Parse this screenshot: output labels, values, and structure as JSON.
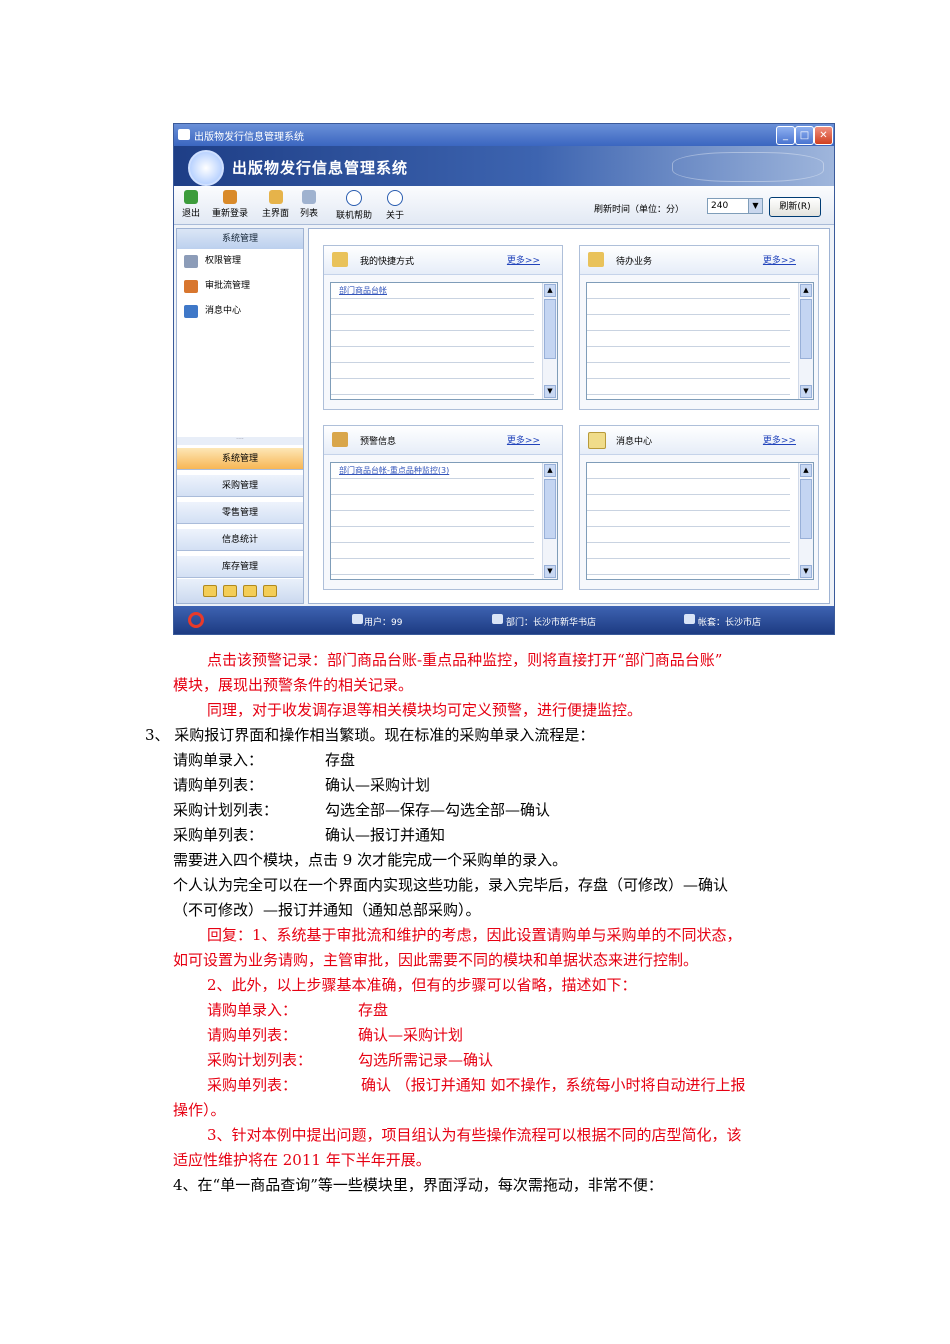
{
  "app": {
    "window_title": "出版物发行信息管理系统",
    "banner_title": "出版物发行信息管理系统",
    "toolbar": [
      "退出",
      "重新登录",
      "主界面",
      "列表",
      "联机帮助",
      "关于"
    ],
    "refresh_label": "刷新时间（单位：分）",
    "refresh_value": "240",
    "refresh_button": "刷新(R)",
    "sidebar_header": "系统管理",
    "sidebar_items": [
      "权限管理",
      "审批流管理",
      "消息中心"
    ],
    "nav_groups": [
      "系统管理",
      "采购管理",
      "零售管理",
      "信息统计",
      "库存管理"
    ],
    "more_label": "更多>>",
    "panels": [
      {
        "title": "我的快捷方式",
        "rows": [
          "部门商品台帐"
        ]
      },
      {
        "title": "待办业务",
        "rows": []
      },
      {
        "title": "预警信息",
        "rows": [
          "部门商品台帐-重点品种监控(3)"
        ]
      },
      {
        "title": "消息中心",
        "rows": []
      }
    ],
    "status": {
      "user": "用户：99",
      "dept": "部门：长沙市新华书店",
      "account": "帐套：长沙市店"
    }
  },
  "doc": {
    "p1a": "点击该预警记录：部门商品台账-重点品种监控，则将直接打开“部门商品台账”",
    "p1b": "模块，展现出预警条件的相关记录。",
    "p2": "同理，对于收发调存退等相关模块均可定义预警，进行便捷监控。",
    "p3": "3、 采购报订界面和操作相当繁琐。现在标准的采购单录入流程是：",
    "steps1": [
      {
        "k": "请购单录入：",
        "v": "存盘"
      },
      {
        "k": "请购单列表：",
        "v": "确认—采购计划"
      },
      {
        "k": "采购计划列表：",
        "v": "勾选全部—保存—勾选全部—确认"
      },
      {
        "k": "采购单列表：",
        "v": "确认—报订并通知"
      }
    ],
    "p4": "需要进入四个模块，点击 9 次才能完成一个采购单的录入。",
    "p5a": "个人认为完全可以在一个界面内实现这些功能，录入完毕后，存盘（可修改）—确认",
    "p5b": "（不可修改）—报订并通知（通知总部采购）。",
    "r1a": "回复：1、系统基于审批流和维护的考虑，因此设置请购单与采购单的不同状态，",
    "r1b": "如可设置为业务请购，主管审批，因此需要不同的模块和单据状态来进行控制。",
    "r2": "2、此外，以上步骤基本准确，但有的步骤可以省略，描述如下：",
    "steps2": [
      {
        "k": "请购单录入：",
        "v": "存盘"
      },
      {
        "k": "请购单列表：",
        "v": "确认—采购计划"
      },
      {
        "k": "采购计划列表：",
        "v": "勾选所需记录—确认"
      },
      {
        "k": "采购单列表：",
        "v": "确认 （报订并通知 如不操作，系统每小时将自动进行上报"
      }
    ],
    "r2b": "操作）。",
    "r3a": "3、针对本例中提出问题，项目组认为有些操作流程可以根据不同的店型简化，该",
    "r3b": "适应性维护将在 2011 年下半年开展。",
    "p6": "4、在“单一商品查询”等一些模块里，界面浮动，每次需拖动，非常不便："
  }
}
